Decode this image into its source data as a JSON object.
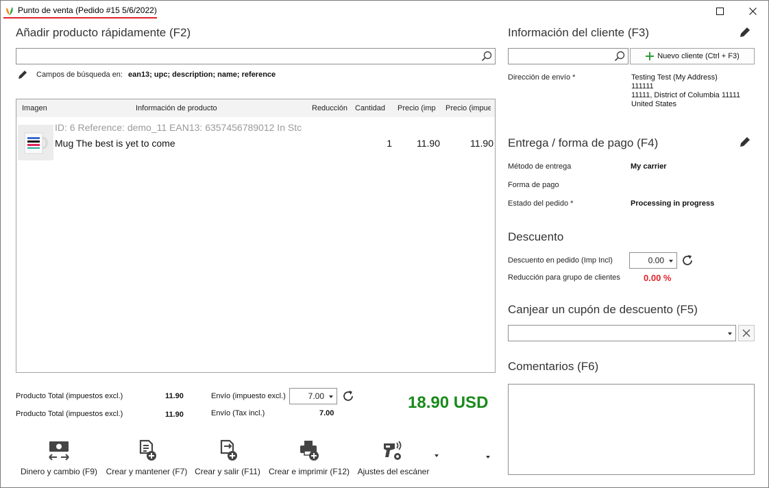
{
  "window": {
    "title": "Punto de venta (Pedido #15 5/6/2022)"
  },
  "quick_add": {
    "title": "Añadir producto rápidamente (F2)",
    "search_value": "",
    "search_fields_label": "Campos de búsqueda en:",
    "search_fields_value": "ean13; upc; description; name; reference"
  },
  "table": {
    "columns": [
      "Imagen",
      "Información de producto",
      "Reducción",
      "Cantidad",
      "Precio (imp",
      "Precio (impue"
    ],
    "rows": [
      {
        "meta": "ID: 6 Reference: demo_11 EAN13: 6357456789012 In Stc",
        "name": "Mug The best is yet to come",
        "quantity": "1",
        "price_excl": "11.90",
        "price_incl": "11.90"
      }
    ]
  },
  "totals": {
    "product_total_excl_label": "Producto Total (impuestos excl.)",
    "product_total_excl_value": "11.90",
    "product_total_incl_label": "Producto Total (impuestos excl.)",
    "product_total_incl_value": "11.90",
    "shipping_excl_label": "Envío (impuesto excl.)",
    "shipping_excl_value": "7.00",
    "shipping_incl_label": "Envío (Tax incl.)",
    "shipping_incl_value": "7.00",
    "grand_total": "18.90 USD"
  },
  "actions": {
    "cash": "Dinero y cambio (F9)",
    "create_keep": "Crear y mantener (F7)",
    "create_exit": "Crear y salir (F11)",
    "create_print": "Crear e imprimir (F12)",
    "scanner": "Ajustes del escáner"
  },
  "customer": {
    "title": "Información del cliente (F3)",
    "search_value": "",
    "new_client_label": "Nuevo cliente (Ctrl + F3)",
    "shipping_address_label": "Dirección de envío *",
    "address_lines": [
      "Testing Test (My Address)",
      "111111",
      "11111, District of Columbia 11111",
      "United States"
    ]
  },
  "delivery": {
    "title": "Entrega / forma de pago (F4)",
    "method_label": "Método de entrega",
    "method_value": "My carrier",
    "payment_label": "Forma de pago",
    "payment_value": "",
    "status_label": "Estado del pedido *",
    "status_value": "Processing in progress"
  },
  "discount": {
    "title": "Descuento",
    "order_discount_label": "Descuento en pedido (Imp Incl)",
    "order_discount_value": "0.00",
    "group_reduction_label": "Reducción para grupo de clientes",
    "group_reduction_value": "0.00 %"
  },
  "coupon": {
    "title": "Canjear un cupón de descuento (F5)",
    "value": ""
  },
  "comments": {
    "title": "Comentarios (F6)",
    "value": ""
  },
  "colors": {
    "accent_red": "#e0212a",
    "total_green": "#1a8a1a",
    "percent_red": "#e4232a"
  },
  "icons": [
    "app-logo-icon",
    "maximize-icon",
    "close-icon",
    "search-icon",
    "pencil-icon",
    "plus-icon",
    "refresh-icon",
    "cash-icon",
    "doc-add-icon",
    "doc-exit-icon",
    "printer-add-icon",
    "scanner-settings-icon",
    "chevron-down-icon",
    "clear-icon"
  ]
}
